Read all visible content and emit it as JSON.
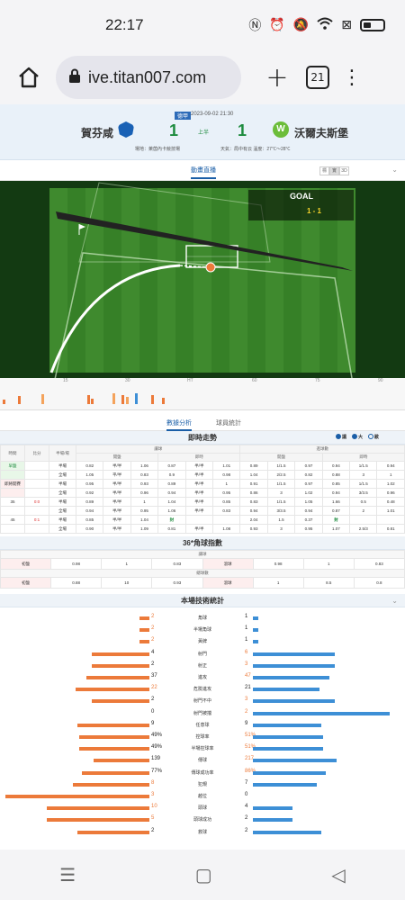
{
  "status": {
    "time": "22:17"
  },
  "browser": {
    "url": "ive.titan007.com",
    "tabs_count": "21"
  },
  "match": {
    "league": "德甲",
    "date": "2023-09-02 21:30",
    "home": "賀芬咸",
    "away": "沃爾夫斯堡",
    "home_score": "1",
    "away_score": "1",
    "half": "上半",
    "venue": "場地：萊茵內卡競技場",
    "weather": "天氣：局中有云  溫度：27℃～28℃"
  },
  "animation": {
    "title": "動畫直播",
    "view_options": [
      "標",
      "實",
      "3D"
    ],
    "goal_label": "GOAL",
    "goal_score": "1 - 1"
  },
  "timeline": {
    "ticks": [
      "15",
      "30",
      "HT",
      "60",
      "75",
      "90"
    ]
  },
  "subtabs": {
    "active": "數據分析",
    "other": "球員統計"
  },
  "odds": {
    "title": "即時走勢",
    "options": [
      "讓",
      "大",
      "歐"
    ],
    "groups": {
      "asian": "讓球",
      "ou": "進球數"
    },
    "headers": {
      "time": "時間",
      "score": "比分",
      "company": "半場/場",
      "open": "開盤",
      "live": "即時"
    },
    "rows": [
      {
        "time": "早盤",
        "score": "",
        "kind": "半場",
        "v": [
          "0.82",
          "半/半",
          "1.06",
          "0.87",
          "半/半",
          "1.01",
          "0.89",
          "1/1.5",
          "0.97",
          "0.94",
          "1/1.5",
          "0.94"
        ]
      },
      {
        "time": "",
        "score": "",
        "kind": "全場",
        "v": [
          "1.05",
          "平/半",
          "0.83",
          "0.9",
          "半/半",
          "0.98",
          "1.04",
          "2/2.5",
          "0.82",
          "0.88",
          "3",
          "1"
        ]
      },
      {
        "time": "即將開賽",
        "score": "",
        "kind": "半場",
        "v": [
          "0.95",
          "半/半",
          "0.93",
          "0.89",
          "半/半",
          "1",
          "0.91",
          "1/1.5",
          "0.97",
          "0.85",
          "1/1.5",
          "1.02"
        ]
      },
      {
        "time": "",
        "score": "",
        "kind": "全場",
        "v": [
          "0.92",
          "半/半",
          "0.96",
          "0.94",
          "半/半",
          "0.95",
          "0.86",
          "3",
          "1.02",
          "0.94",
          "3/3.5",
          "0.96"
        ]
      },
      {
        "time": "35",
        "score": "0:0",
        "kind": "半場",
        "v": [
          "0.89",
          "半/半",
          "1",
          "1.04",
          "半/半",
          "0.85",
          "0.83",
          "1/1.5",
          "1.05",
          "1.66",
          "0.5",
          "0.48"
        ]
      },
      {
        "time": "",
        "score": "",
        "kind": "全場",
        "v": [
          "0.94",
          "半/半",
          "0.95",
          "1.06",
          "半/半",
          "0.83",
          "0.94",
          "3/3.5",
          "0.94",
          "0.87",
          "2",
          "1.01"
        ]
      },
      {
        "time": "45",
        "score": "0:1",
        "kind": "半場",
        "v": [
          "0.85",
          "半/半",
          "1.04",
          "封",
          "",
          "",
          "2.04",
          "1.5",
          "0.37",
          "封",
          "",
          ""
        ]
      },
      {
        "time": "",
        "score": "",
        "kind": "全場",
        "v": [
          "0.90",
          "半/半",
          "1.09",
          "0.81",
          "半/半",
          "1.08",
          "0.93",
          "3",
          "0.95",
          "1.07",
          "2.5/3",
          "0.81"
        ]
      }
    ]
  },
  "corners": {
    "title": "36*角球指數",
    "rows": [
      {
        "group": "讓球",
        "label": "初盤",
        "v": [
          "0.98",
          "1",
          "0.83"
        ],
        "label2": "滾球",
        "v2": [
          "0.98",
          "1",
          "0.83"
        ]
      },
      {
        "group": "總球數",
        "label": "初盤",
        "v": [
          "0.88",
          "10",
          "0.93"
        ],
        "label2": "滾球",
        "v2": [
          "1",
          "8.5",
          "0.8"
        ]
      }
    ]
  },
  "stats": {
    "title": "本場技術統計",
    "rows": [
      {
        "label": "角球",
        "home": "2",
        "away": "1",
        "hr": 0.07,
        "ar": 0.04
      },
      {
        "label": "半場角球",
        "home": "2",
        "away": "1",
        "hr": 0.07,
        "ar": 0.04
      },
      {
        "label": "黃牌",
        "home": "2",
        "away": "1",
        "hr": 0.07,
        "ar": 0.04
      },
      {
        "label": "射門",
        "home": "4",
        "away": "6",
        "hr": 0.4,
        "ar": 0.6
      },
      {
        "label": "射正",
        "home": "2",
        "away": "3",
        "hr": 0.4,
        "ar": 0.6
      },
      {
        "label": "進攻",
        "home": "37",
        "away": "47",
        "hr": 0.44,
        "ar": 0.56
      },
      {
        "label": "危險進攻",
        "home": "22",
        "away": "21",
        "hr": 0.51,
        "ar": 0.49
      },
      {
        "label": "射門不中",
        "home": "2",
        "away": "3",
        "hr": 0.4,
        "ar": 0.6
      },
      {
        "label": "射門被擋",
        "home": "0",
        "away": "2",
        "hr": 0.0,
        "ar": 1.0
      },
      {
        "label": "任意球",
        "home": "9",
        "away": "9",
        "hr": 0.5,
        "ar": 0.5
      },
      {
        "label": "控球率",
        "home": "49%",
        "away": "51%",
        "hr": 0.49,
        "ar": 0.51
      },
      {
        "label": "半場控球率",
        "home": "49%",
        "away": "51%",
        "hr": 0.49,
        "ar": 0.51
      },
      {
        "label": "傳球",
        "home": "139",
        "away": "217",
        "hr": 0.39,
        "ar": 0.61
      },
      {
        "label": "傳球成功率",
        "home": "77%",
        "away": "86%",
        "hr": 0.47,
        "ar": 0.53
      },
      {
        "label": "犯規",
        "home": "8",
        "away": "7",
        "hr": 0.53,
        "ar": 0.47
      },
      {
        "label": "越位",
        "home": "3",
        "away": "0",
        "hr": 1.0,
        "ar": 0.0
      },
      {
        "label": "頭球",
        "home": "10",
        "away": "4",
        "hr": 0.71,
        "ar": 0.29
      },
      {
        "label": "頭球成功",
        "home": "5",
        "away": "2",
        "hr": 0.71,
        "ar": 0.29
      },
      {
        "label": "救球",
        "home": "2",
        "away": "2",
        "hr": 0.5,
        "ar": 0.5
      }
    ]
  },
  "colors": {
    "home_bar": "#ec7a3a",
    "away_bar": "#3d8fd6",
    "score_green": "#1d8b3e",
    "accent_blue": "#1a5ea7"
  }
}
